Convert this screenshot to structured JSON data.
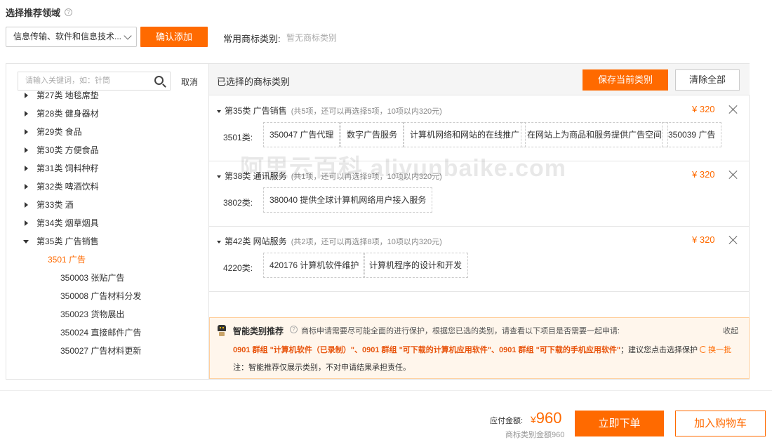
{
  "section": {
    "title": "选择推荐领域"
  },
  "domain_select": {
    "value": "信息传输、软件和信息技术..."
  },
  "confirm_add_label": "确认添加",
  "common": {
    "label": "常用商标类别:",
    "value": "暂无商标类别"
  },
  "search": {
    "placeholder": "请输入关键词，如：针筒",
    "cancel_label": "取消"
  },
  "tree": {
    "classes": [
      {
        "label": "第27类 地毯席垫"
      },
      {
        "label": "第28类 健身器材"
      },
      {
        "label": "第29类 食品"
      },
      {
        "label": "第30类 方便食品"
      },
      {
        "label": "第31类 饲料种籽"
      },
      {
        "label": "第32类 啤酒饮料"
      },
      {
        "label": "第33类 酒"
      },
      {
        "label": "第34类 烟草烟具"
      },
      {
        "label": "第35类 广告销售"
      }
    ],
    "subgroup": "3501 广告",
    "items": [
      "350003 张贴广告",
      "350008 广告材料分发",
      "350023 货物展出",
      "350024 直接邮件广告",
      "350027 广告材料更新"
    ]
  },
  "selected": {
    "header_label": "已选择的商标类别",
    "save_label": "保存当前类别",
    "clear_label": "清除全部",
    "groups": [
      {
        "class_label": "第35类 广告销售",
        "note": "(共5项，还可以再选择5项，10项以内320元)",
        "price": "¥ 320",
        "code": "3501类:",
        "items": [
          "350047 广告代理",
          "数字广告服务",
          "计算机网络和网站的在线推广",
          "在网站上为商品和服务提供广告空间",
          "350039 广告"
        ]
      },
      {
        "class_label": "第38类 通讯服务",
        "note": "(共1项，还可以再选择9项，10项以内320元)",
        "price": "¥ 320",
        "code": "3802类:",
        "items": [
          "380040 提供全球计算机网络用户接入服务"
        ]
      },
      {
        "class_label": "第42类 网站服务",
        "note": "(共2项，还可以再选择8项，10项以内320元)",
        "price": "¥ 320",
        "code": "4220类:",
        "items": [
          "420176 计算机软件维护",
          "计算机程序的设计和开发"
        ]
      }
    ]
  },
  "smart": {
    "title": "智能类别推荐",
    "desc": "商标申请需要尽可能全面的进行保护，根据您已选的类别，请查看以下项目是否需要一起申请:",
    "collapse": "收起",
    "highlight": "0901 群组 \"计算机软件（已录制）\"、0901 群组 \"可下载的计算机应用软件\"、0901 群组 \"可下载的手机应用软件\"",
    "suggest": "；建议您点击选择保护",
    "refresh": "换一批",
    "note": "注：智能推荐仅展示类别，不对申请结果承担责任。"
  },
  "footer": {
    "pay_label": "应付金额:",
    "currency": "¥",
    "amount": "960",
    "sub": "商标类别金额960",
    "order_label": "立即下单",
    "cart_label": "加入购物车"
  },
  "watermark": "阿里云百科 aliyunbaike.com",
  "colors": {
    "accent": "#ff6a00"
  }
}
